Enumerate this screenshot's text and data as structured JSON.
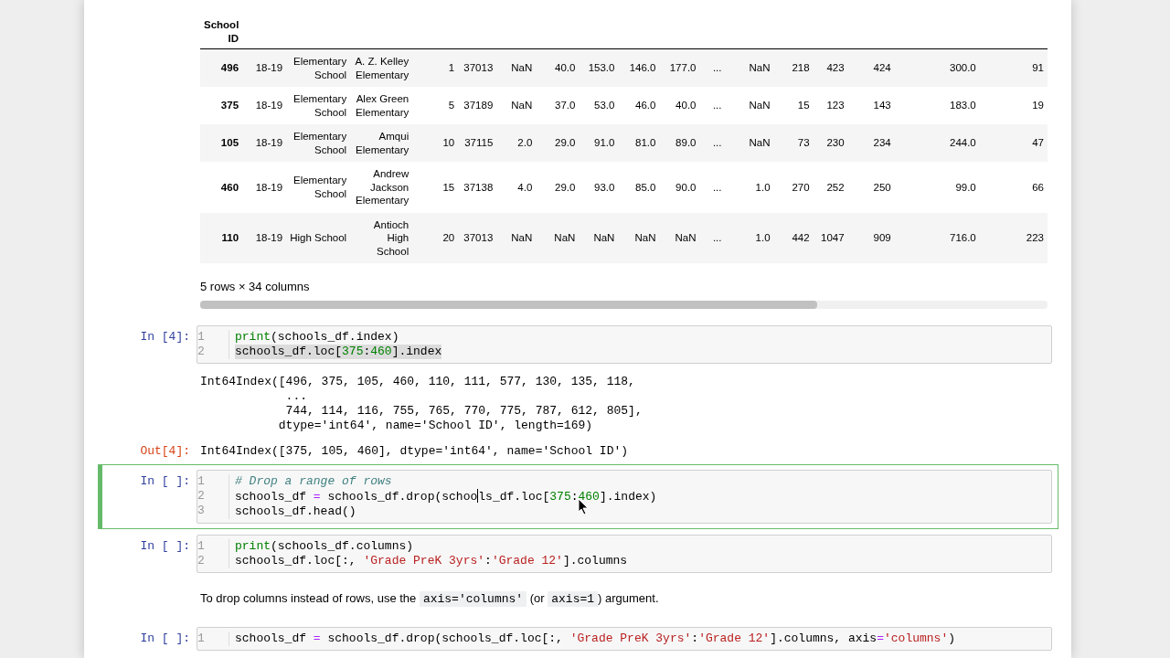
{
  "dataframe": {
    "index_name": "School ID",
    "rows": [
      {
        "index": "496",
        "cells": [
          "18-19",
          "Elementary School",
          "A. Z. Kelley Elementary",
          "1",
          "37013",
          "NaN",
          "40.0",
          "153.0",
          "146.0",
          "177.0",
          "...",
          "NaN",
          "218",
          "423",
          "424",
          "300.0",
          "91"
        ]
      },
      {
        "index": "375",
        "cells": [
          "18-19",
          "Elementary School",
          "Alex Green Elementary",
          "5",
          "37189",
          "NaN",
          "37.0",
          "53.0",
          "46.0",
          "40.0",
          "...",
          "NaN",
          "15",
          "123",
          "143",
          "183.0",
          "19"
        ]
      },
      {
        "index": "105",
        "cells": [
          "18-19",
          "Elementary School",
          "Amqui Elementary",
          "10",
          "37115",
          "2.0",
          "29.0",
          "91.0",
          "81.0",
          "89.0",
          "...",
          "NaN",
          "73",
          "230",
          "234",
          "244.0",
          "47"
        ]
      },
      {
        "index": "460",
        "cells": [
          "18-19",
          "Elementary School",
          "Andrew Jackson Elementary",
          "15",
          "37138",
          "4.0",
          "29.0",
          "93.0",
          "85.0",
          "90.0",
          "...",
          "1.0",
          "270",
          "252",
          "250",
          "99.0",
          "66"
        ]
      },
      {
        "index": "110",
        "cells": [
          "18-19",
          "High School",
          "Antioch High School",
          "20",
          "37013",
          "NaN",
          "NaN",
          "NaN",
          "NaN",
          "NaN",
          "...",
          "1.0",
          "442",
          "1047",
          "909",
          "716.0",
          "223"
        ]
      }
    ],
    "shape": "5 rows × 34 columns"
  },
  "cells": [
    {
      "kind": "code",
      "prompt": "In [4]:",
      "selected": false,
      "lines": [
        {
          "number": "1",
          "highlighted": false,
          "tokens": [
            {
              "text": "print",
              "kind": "builtin"
            },
            {
              "text": "(schools_df.index)",
              "kind": "plain"
            }
          ]
        },
        {
          "number": "2",
          "highlighted": true,
          "tokens": [
            {
              "text": "schools_df.loc[",
              "kind": "plain"
            },
            {
              "text": "375",
              "kind": "number"
            },
            {
              "text": ":",
              "kind": "plain"
            },
            {
              "text": "460",
              "kind": "number"
            },
            {
              "text": "].index",
              "kind": "plain"
            }
          ]
        }
      ]
    },
    {
      "kind": "stream",
      "lines": [
        "Int64Index([496, 375, 105, 460, 110, 111, 577, 130, 135, 118,",
        "            ...",
        "            744, 114, 116, 755, 765, 770, 775, 787, 612, 805],",
        "           dtype='int64', name='School ID', length=169)"
      ]
    },
    {
      "kind": "result",
      "prompt": "Out[4]:",
      "lines": [
        "Int64Index([375, 105, 460], dtype='int64', name='School ID')"
      ]
    },
    {
      "kind": "code",
      "prompt": "In [ ]:",
      "selected": true,
      "lines": [
        {
          "number": "1",
          "highlighted": false,
          "tokens": [
            {
              "text": "# Drop a range of rows",
              "kind": "comment"
            }
          ]
        },
        {
          "number": "2",
          "highlighted": false,
          "tokens": [
            {
              "text": "schools_df ",
              "kind": "plain"
            },
            {
              "text": "=",
              "kind": "operator"
            },
            {
              "text": " schools_df.drop(schoo",
              "kind": "plain"
            },
            {
              "kind": "caret"
            },
            {
              "text": "ls_df.loc[",
              "kind": "plain"
            },
            {
              "text": "375",
              "kind": "number"
            },
            {
              "text": ":",
              "kind": "plain"
            },
            {
              "text": "460",
              "kind": "number"
            },
            {
              "text": "].index)",
              "kind": "plain"
            }
          ]
        },
        {
          "number": "3",
          "highlighted": false,
          "tokens": [
            {
              "text": "schools_df.head()",
              "kind": "plain"
            }
          ]
        }
      ]
    },
    {
      "kind": "code",
      "prompt": "In [ ]:",
      "selected": false,
      "lines": [
        {
          "number": "1",
          "highlighted": false,
          "tokens": [
            {
              "text": "print",
              "kind": "builtin"
            },
            {
              "text": "(schools_df.columns)",
              "kind": "plain"
            }
          ]
        },
        {
          "number": "2",
          "highlighted": false,
          "tokens": [
            {
              "text": "schools_df.loc[:, ",
              "kind": "plain"
            },
            {
              "text": "'Grade PreK 3yrs'",
              "kind": "string"
            },
            {
              "text": ":",
              "kind": "plain"
            },
            {
              "text": "'Grade 12'",
              "kind": "string"
            },
            {
              "text": "].columns",
              "kind": "plain"
            }
          ]
        }
      ]
    },
    {
      "kind": "markdown",
      "segments": [
        {
          "text": "To drop columns instead of rows, use the ",
          "kind": "text"
        },
        {
          "text": "axis='columns'",
          "kind": "code"
        },
        {
          "text": " (or ",
          "kind": "text"
        },
        {
          "text": "axis=1",
          "kind": "code"
        },
        {
          "text": ") argument.",
          "kind": "text"
        }
      ]
    },
    {
      "kind": "code",
      "prompt": "In [ ]:",
      "selected": false,
      "lines": [
        {
          "number": "1",
          "highlighted": false,
          "tokens": [
            {
              "text": "schools_df ",
              "kind": "plain"
            },
            {
              "text": "=",
              "kind": "operator"
            },
            {
              "text": " schools_df.drop(schools_df.loc[:, ",
              "kind": "plain"
            },
            {
              "text": "'Grade PreK 3yrs'",
              "kind": "string"
            },
            {
              "text": ":",
              "kind": "plain"
            },
            {
              "text": "'Grade 12'",
              "kind": "string"
            },
            {
              "text": "].columns, axis",
              "kind": "plain"
            },
            {
              "text": "=",
              "kind": "operator"
            },
            {
              "text": "'columns'",
              "kind": "string"
            },
            {
              "text": ")",
              "kind": "plain"
            }
          ]
        }
      ]
    }
  ]
}
